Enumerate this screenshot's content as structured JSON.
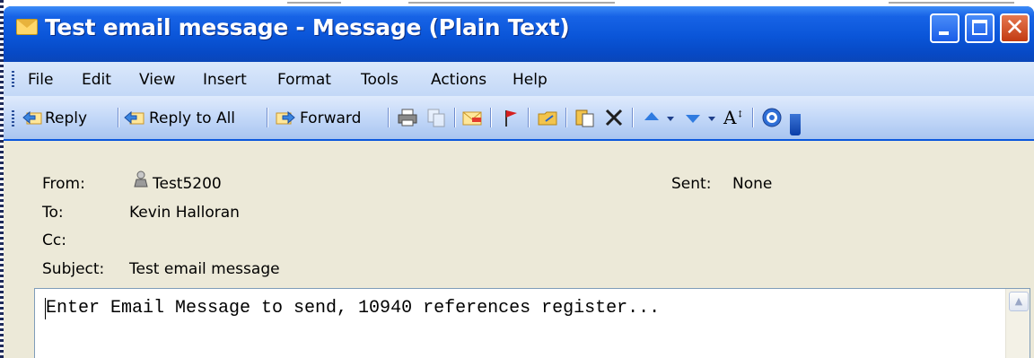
{
  "window": {
    "title": "Test email message - Message (Plain Text)"
  },
  "menu": [
    "File",
    "Edit",
    "View",
    "Insert",
    "Format",
    "Tools",
    "Actions",
    "Help"
  ],
  "toolbar": {
    "reply_label": "Reply",
    "reply_all_label": "Reply to All",
    "forward_label": "Forward"
  },
  "header": {
    "from_label": "From:",
    "from_value": "Test5200",
    "sent_label": "Sent:",
    "sent_value": "None",
    "to_label": "To:",
    "to_value": "Kevin Halloran",
    "cc_label": "Cc:",
    "cc_value": "",
    "subject_label": "Subject:",
    "subject_value": "Test email message"
  },
  "body": {
    "text": "Enter Email Message to send, 10940 references register..."
  },
  "colors": {
    "titlebar": "#0a57dd",
    "header_bg": "#ece9d8",
    "close_button": "#c23b12"
  },
  "icons": [
    "mail-envelope-icon",
    "reply-icon",
    "reply-all-icon",
    "forward-icon",
    "print-icon",
    "copy-icon",
    "move-to-folder-icon",
    "flag-icon",
    "delete-icon",
    "previous-item-icon",
    "next-item-icon",
    "font-size-icon",
    "help-icon",
    "toolbar-options-icon",
    "contact-person-icon"
  ]
}
